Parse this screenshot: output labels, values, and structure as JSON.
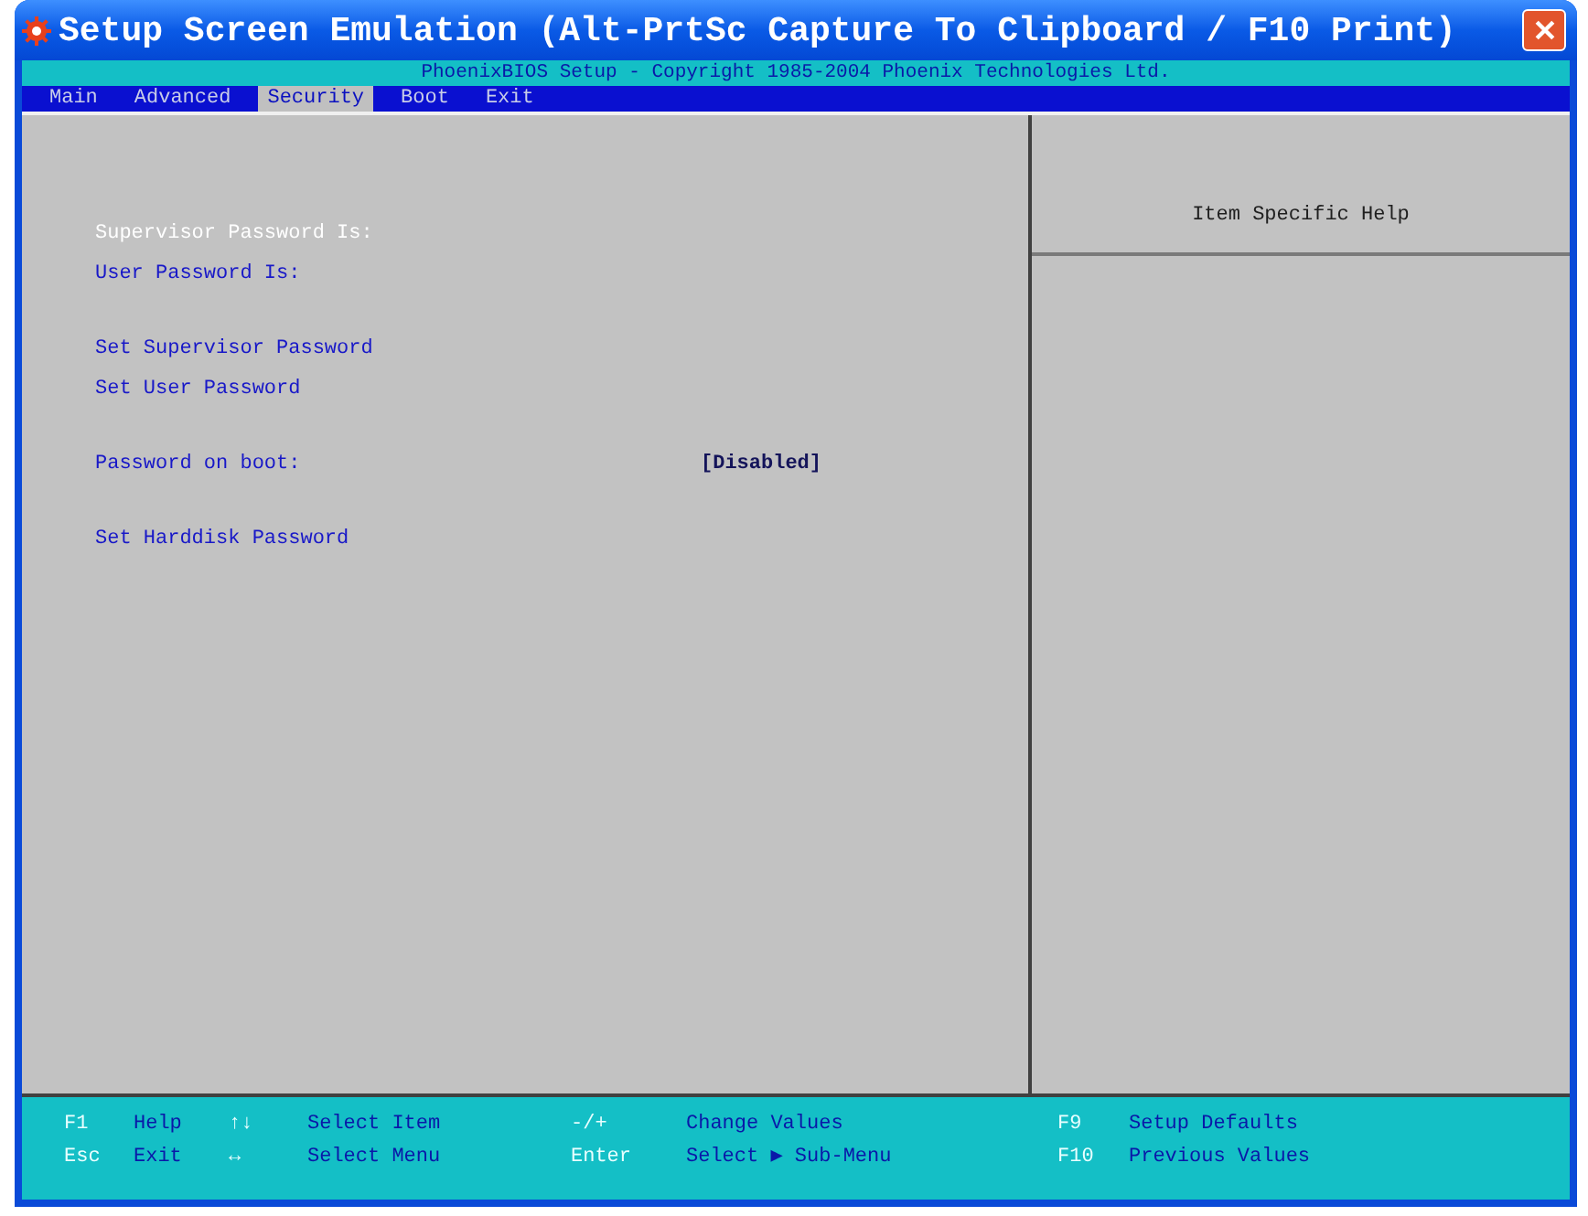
{
  "window": {
    "title": "Setup Screen Emulation (Alt-PrtSc Capture To Clipboard / F10 Print)"
  },
  "header": {
    "text": "PhoenixBIOS Setup - Copyright 1985-2004 Phoenix Technologies Ltd."
  },
  "menu": [
    {
      "label": "Main",
      "selected": false
    },
    {
      "label": "Advanced",
      "selected": false
    },
    {
      "label": "Security",
      "selected": true
    },
    {
      "label": "Boot",
      "selected": false
    },
    {
      "label": "Exit",
      "selected": false
    }
  ],
  "settings": [
    {
      "items": [
        {
          "label": "Supervisor Password Is:",
          "selected": true
        },
        {
          "label": "User Password Is:",
          "selected": false
        }
      ]
    },
    {
      "items": [
        {
          "label": "Set Supervisor Password",
          "selected": false
        },
        {
          "label": "Set User Password",
          "selected": false
        }
      ]
    },
    {
      "items": [
        {
          "label": "Password on boot:",
          "value": "[Disabled]",
          "selected": false
        }
      ]
    },
    {
      "items": [
        {
          "label": "Set Harddisk Password",
          "selected": false
        }
      ]
    }
  ],
  "help_panel": {
    "title": "Item Specific Help"
  },
  "key_legend": [
    [
      {
        "key": "F1",
        "action": "Help"
      },
      {
        "key": "↑↓",
        "action": "Select Item"
      },
      {
        "key": "-/+",
        "action": "Change Values"
      },
      {
        "key": "F9",
        "action": "Setup Defaults"
      }
    ],
    [
      {
        "key": "Esc",
        "action": "Exit"
      },
      {
        "key": "↔",
        "action": "Select Menu"
      },
      {
        "key": "Enter",
        "action": "Select ▶ Sub-Menu"
      },
      {
        "key": "F10",
        "action": "Previous Values"
      }
    ]
  ]
}
